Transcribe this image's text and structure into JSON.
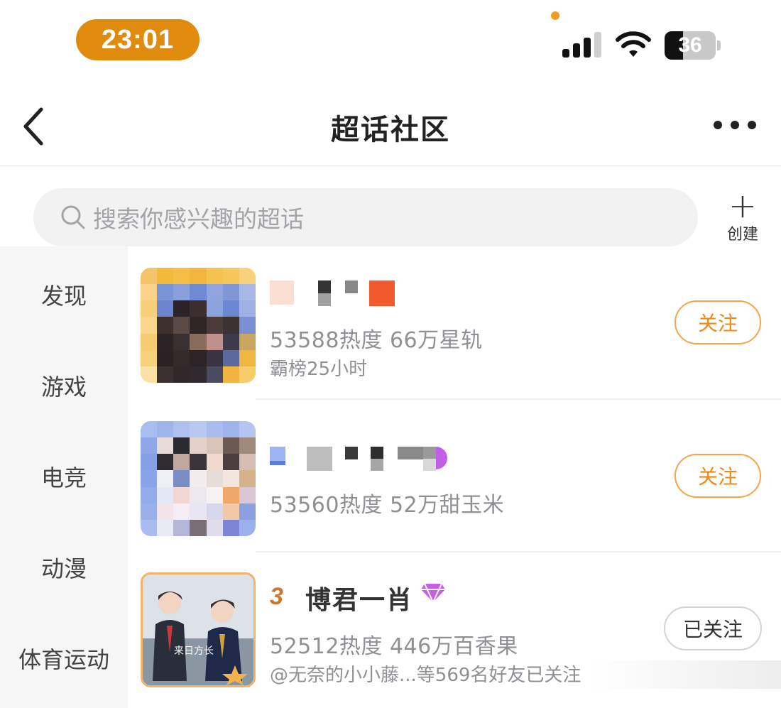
{
  "status_bar": {
    "time": "23:01",
    "battery": "36",
    "battery_level": 0.36
  },
  "header": {
    "title": "超话社区"
  },
  "search": {
    "placeholder": "搜索你感兴趣的超话"
  },
  "create": {
    "label": "创建"
  },
  "sidebar": {
    "items": [
      "发现",
      "游戏",
      "电竞",
      "动漫",
      "体育运动"
    ]
  },
  "topics": [
    {
      "name": "",
      "stats": "53588热度 66万星轨",
      "sub": "霸榜25小时",
      "button": "关注",
      "followed": false
    },
    {
      "name": "",
      "stats": "53560热度 52万甜玉米",
      "sub": "",
      "button": "关注",
      "followed": false
    },
    {
      "name": "博君一肖",
      "rank": "3",
      "stats": "52512热度 446万百香果",
      "sub": "@无奈的小小藤...等569名好友已关注",
      "button": "已关注",
      "followed": true
    }
  ],
  "colors": {
    "accent": "#ee8a1a",
    "time_pill": "#e08a0e"
  },
  "icons": [
    "signal-icon",
    "wifi-icon",
    "battery-icon",
    "back-icon",
    "more-icon",
    "search-icon",
    "plus-icon",
    "diamond-icon"
  ]
}
